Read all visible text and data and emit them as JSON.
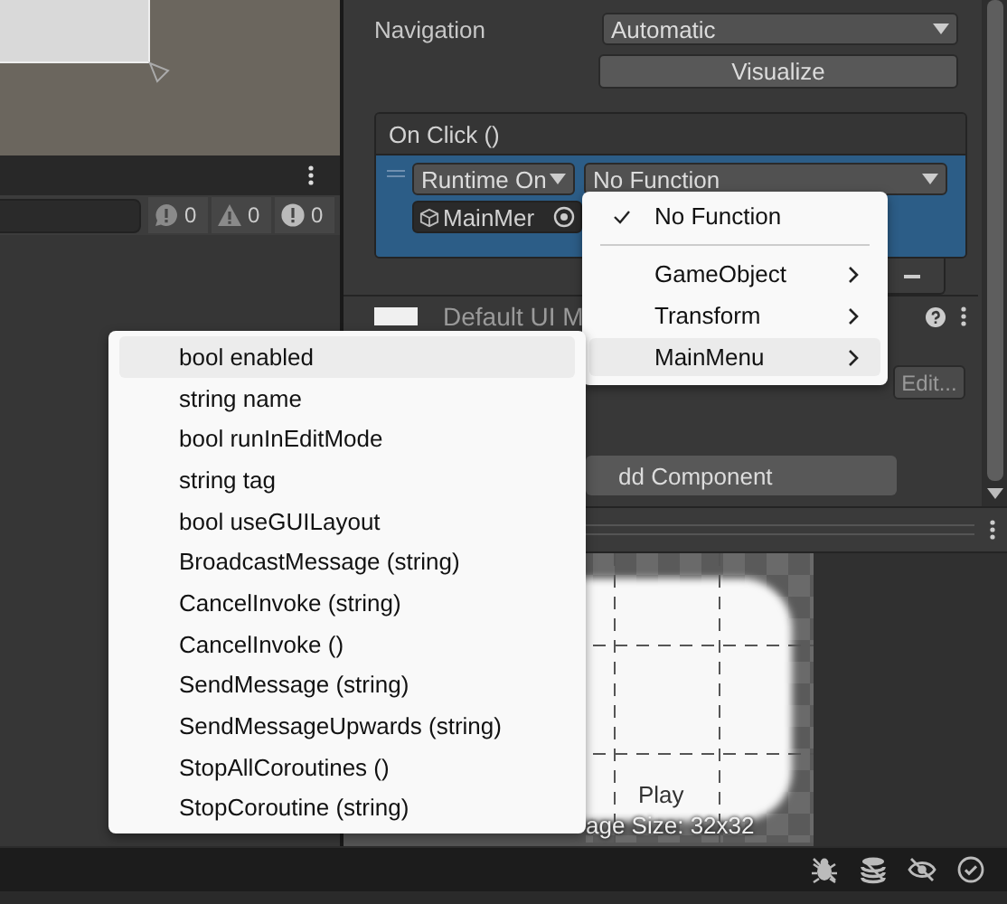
{
  "console": {
    "counts": [
      {
        "kind": "info",
        "text": "0"
      },
      {
        "kind": "warning",
        "text": "0"
      },
      {
        "kind": "error",
        "text": "0"
      }
    ]
  },
  "inspector": {
    "navigation": {
      "label": "Navigation",
      "value": "Automatic"
    },
    "visualize_button": "Visualize",
    "on_click": {
      "title": "On Click ()",
      "runtime": "Runtime On",
      "function": "No Function",
      "target": "MainMer"
    },
    "material": {
      "name": "Default UI M",
      "edit_button": "Edit..."
    },
    "add_component_button": "dd Component"
  },
  "preview": {
    "title": "Play",
    "size": "age Size: 32x32"
  },
  "function_menu": [
    {
      "label": "No Function",
      "checked": true,
      "has_submenu": false,
      "separator_after": true,
      "selected": false
    },
    {
      "label": "GameObject",
      "checked": false,
      "has_submenu": true,
      "separator_after": false,
      "selected": false
    },
    {
      "label": "Transform",
      "checked": false,
      "has_submenu": true,
      "separator_after": false,
      "selected": false
    },
    {
      "label": "MainMenu",
      "checked": false,
      "has_submenu": true,
      "separator_after": false,
      "selected": true
    }
  ],
  "submenu": [
    {
      "label": "bool enabled",
      "selected": true
    },
    {
      "label": "string name",
      "selected": false
    },
    {
      "label": "bool runInEditMode",
      "selected": false
    },
    {
      "label": "string tag",
      "selected": false
    },
    {
      "label": "bool useGUILayout",
      "selected": false
    },
    {
      "label": "BroadcastMessage (string)",
      "selected": false
    },
    {
      "label": "CancelInvoke (string)",
      "selected": false
    },
    {
      "label": "CancelInvoke ()",
      "selected": false
    },
    {
      "label": "SendMessage (string)",
      "selected": false
    },
    {
      "label": "SendMessageUpwards (string)",
      "selected": false
    },
    {
      "label": "StopAllCoroutines ()",
      "selected": false
    },
    {
      "label": "StopCoroutine (string)",
      "selected": false
    }
  ]
}
